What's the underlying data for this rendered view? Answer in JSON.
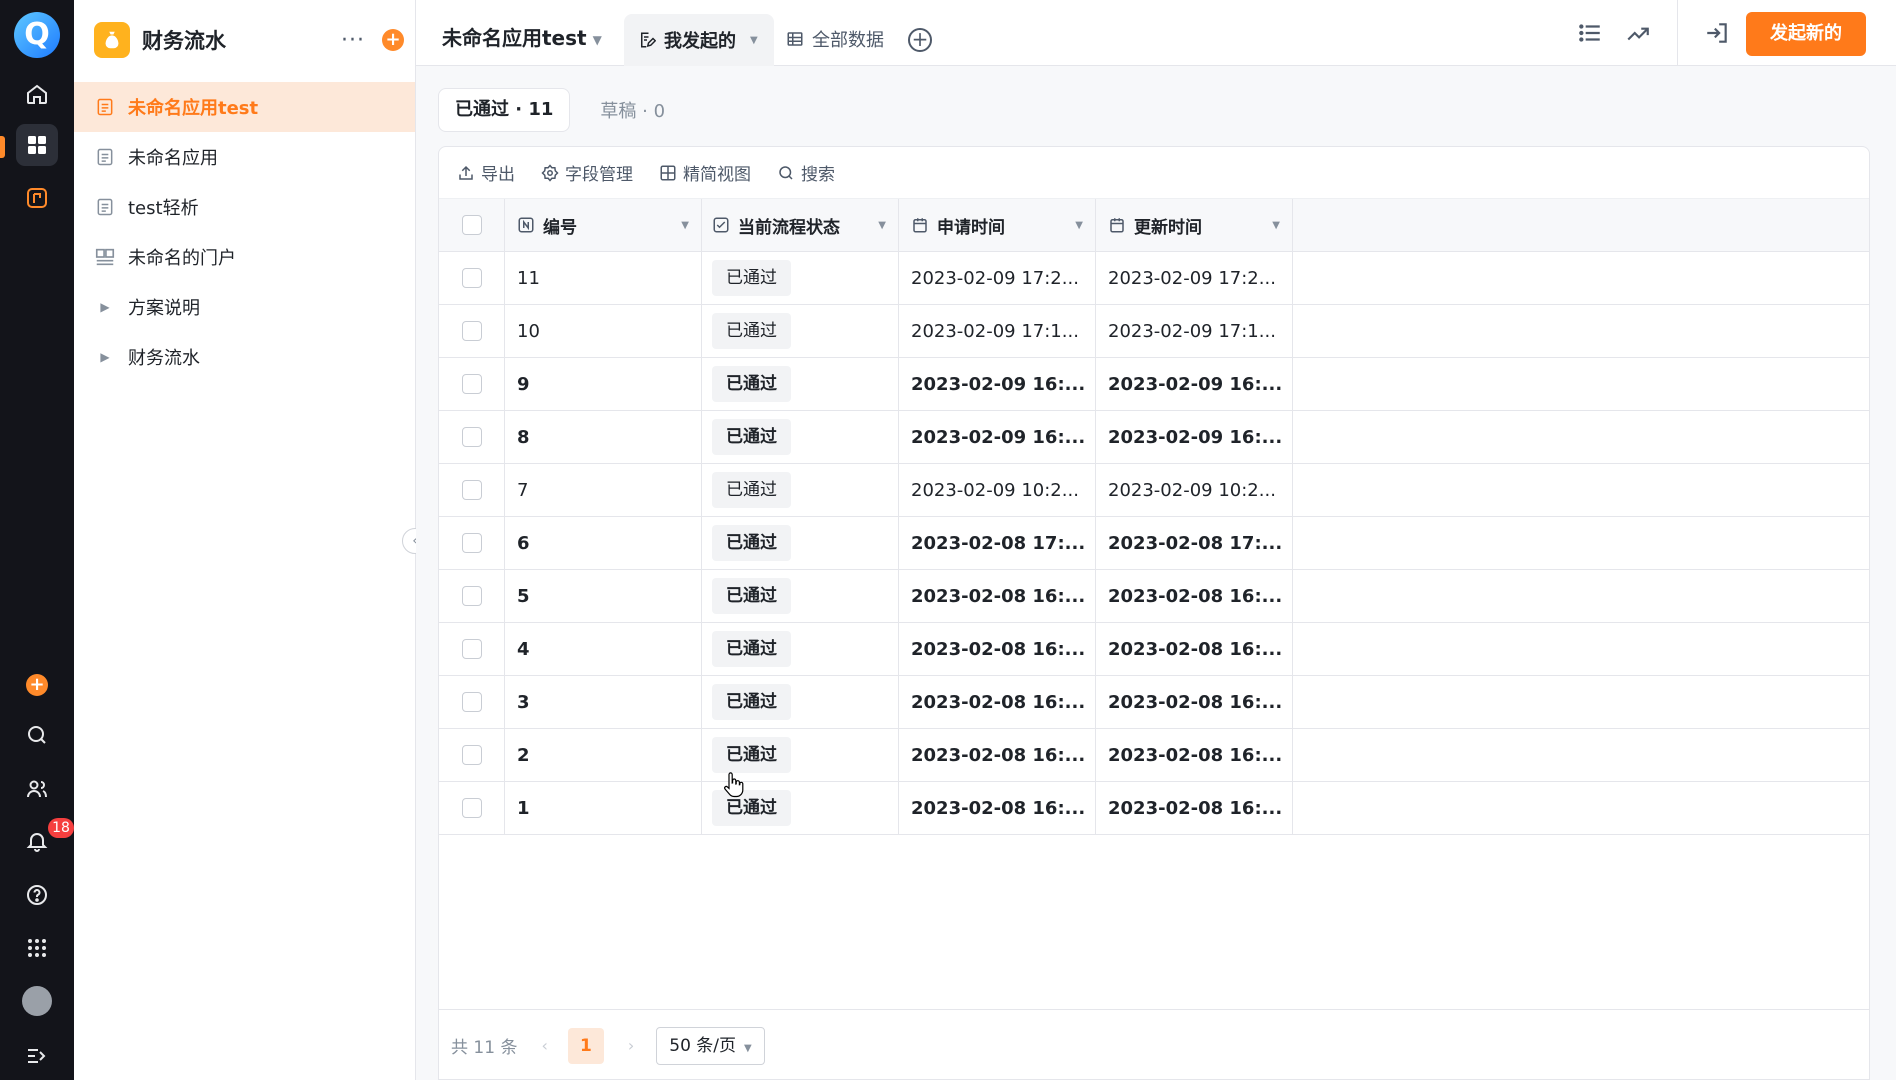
{
  "colors": {
    "accent": "#ff7a1a",
    "rail_bg": "#13141a",
    "active_item_bg": "#fde8d9",
    "badge": "#f53f3f"
  },
  "rail": {
    "logo_letter": "Q",
    "notification_count": "18",
    "icons": [
      "home-icon",
      "apps-grid-icon",
      "portal-icon",
      "add-icon",
      "search-icon",
      "contacts-icon",
      "bell-icon",
      "help-icon",
      "app-launcher-icon",
      "avatar",
      "expand-icon"
    ]
  },
  "sidebar": {
    "title": "财务流水",
    "more": "···",
    "add": "+",
    "items": [
      {
        "label": "未命名应用test",
        "icon": "form-icon",
        "active": true
      },
      {
        "label": "未命名应用",
        "icon": "form-icon"
      },
      {
        "label": "test轻析",
        "icon": "form-icon"
      },
      {
        "label": "未命名的门户",
        "icon": "portal-layout-icon"
      },
      {
        "label": "方案说明",
        "icon": "caret-right-icon"
      },
      {
        "label": "财务流水",
        "icon": "caret-right-icon"
      }
    ]
  },
  "topbar": {
    "app_name": "未命名应用test",
    "tab_mine": "我发起的",
    "tab_all": "全部数据",
    "new_button": "发起新的"
  },
  "status_tabs": {
    "approved": "已通过 · 11",
    "draft": "草稿 · 0"
  },
  "toolbar": {
    "export": "导出",
    "fields": "字段管理",
    "compact": "精简视图",
    "search": "搜索"
  },
  "table": {
    "columns": [
      "编号",
      "当前流程状态",
      "申请时间",
      "更新时间"
    ],
    "rows": [
      {
        "no": "11",
        "status": "已通过",
        "applied": "2023-02-09 17:2...",
        "updated": "2023-02-09 17:2...",
        "bold": false
      },
      {
        "no": "10",
        "status": "已通过",
        "applied": "2023-02-09 17:1...",
        "updated": "2023-02-09 17:1...",
        "bold": false
      },
      {
        "no": "9",
        "status": "已通过",
        "applied": "2023-02-09 16:...",
        "updated": "2023-02-09 16:...",
        "bold": true
      },
      {
        "no": "8",
        "status": "已通过",
        "applied": "2023-02-09 16:...",
        "updated": "2023-02-09 16:...",
        "bold": true
      },
      {
        "no": "7",
        "status": "已通过",
        "applied": "2023-02-09 10:2...",
        "updated": "2023-02-09 10:2...",
        "bold": false
      },
      {
        "no": "6",
        "status": "已通过",
        "applied": "2023-02-08 17:...",
        "updated": "2023-02-08 17:...",
        "bold": true
      },
      {
        "no": "5",
        "status": "已通过",
        "applied": "2023-02-08 16:...",
        "updated": "2023-02-08 16:...",
        "bold": true
      },
      {
        "no": "4",
        "status": "已通过",
        "applied": "2023-02-08 16:...",
        "updated": "2023-02-08 16:...",
        "bold": true
      },
      {
        "no": "3",
        "status": "已通过",
        "applied": "2023-02-08 16:...",
        "updated": "2023-02-08 16:...",
        "bold": true
      },
      {
        "no": "2",
        "status": "已通过",
        "applied": "2023-02-08 16:...",
        "updated": "2023-02-08 16:...",
        "bold": true
      },
      {
        "no": "1",
        "status": "已通过",
        "applied": "2023-02-08 16:...",
        "updated": "2023-02-08 16:...",
        "bold": true
      }
    ]
  },
  "pagination": {
    "total": "共 11 条",
    "prev": "‹",
    "current_page": "1",
    "next": "›",
    "page_size": "50 条/页"
  }
}
